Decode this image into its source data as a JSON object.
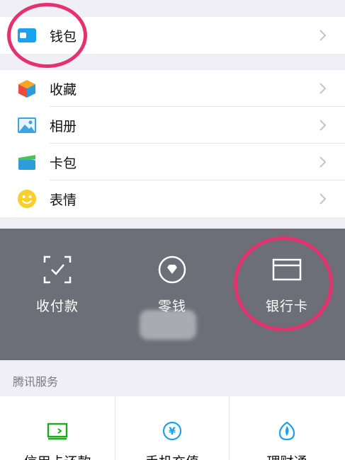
{
  "wallet_row": {
    "label": "钱包",
    "icon": "wallet-icon"
  },
  "menu": [
    {
      "label": "收藏",
      "icon": "favorites-cube-icon"
    },
    {
      "label": "相册",
      "icon": "album-photo-icon"
    },
    {
      "label": "卡包",
      "icon": "card-pack-icon"
    },
    {
      "label": "表情",
      "icon": "emoji-smile-icon"
    }
  ],
  "wallet_panel": {
    "items": [
      {
        "label": "收付款",
        "icon": "scan-pay-icon"
      },
      {
        "label": "零钱",
        "icon": "change-diamond-icon"
      },
      {
        "label": "银行卡",
        "icon": "bank-card-icon"
      }
    ]
  },
  "tencent_services": {
    "title": "腾讯服务",
    "items": [
      {
        "label": "信用卡还款",
        "icon": "credit-card-repay-icon"
      },
      {
        "label": "手机充值",
        "icon": "yen-topup-icon"
      },
      {
        "label": "理财通",
        "icon": "wealth-icon"
      }
    ]
  },
  "colors": {
    "background": "#f0eff5",
    "wallet_panel": "#6c6f78",
    "annotation": "#e4326f",
    "wallet_icon": "#1aa1f0",
    "green": "#1aad19"
  }
}
